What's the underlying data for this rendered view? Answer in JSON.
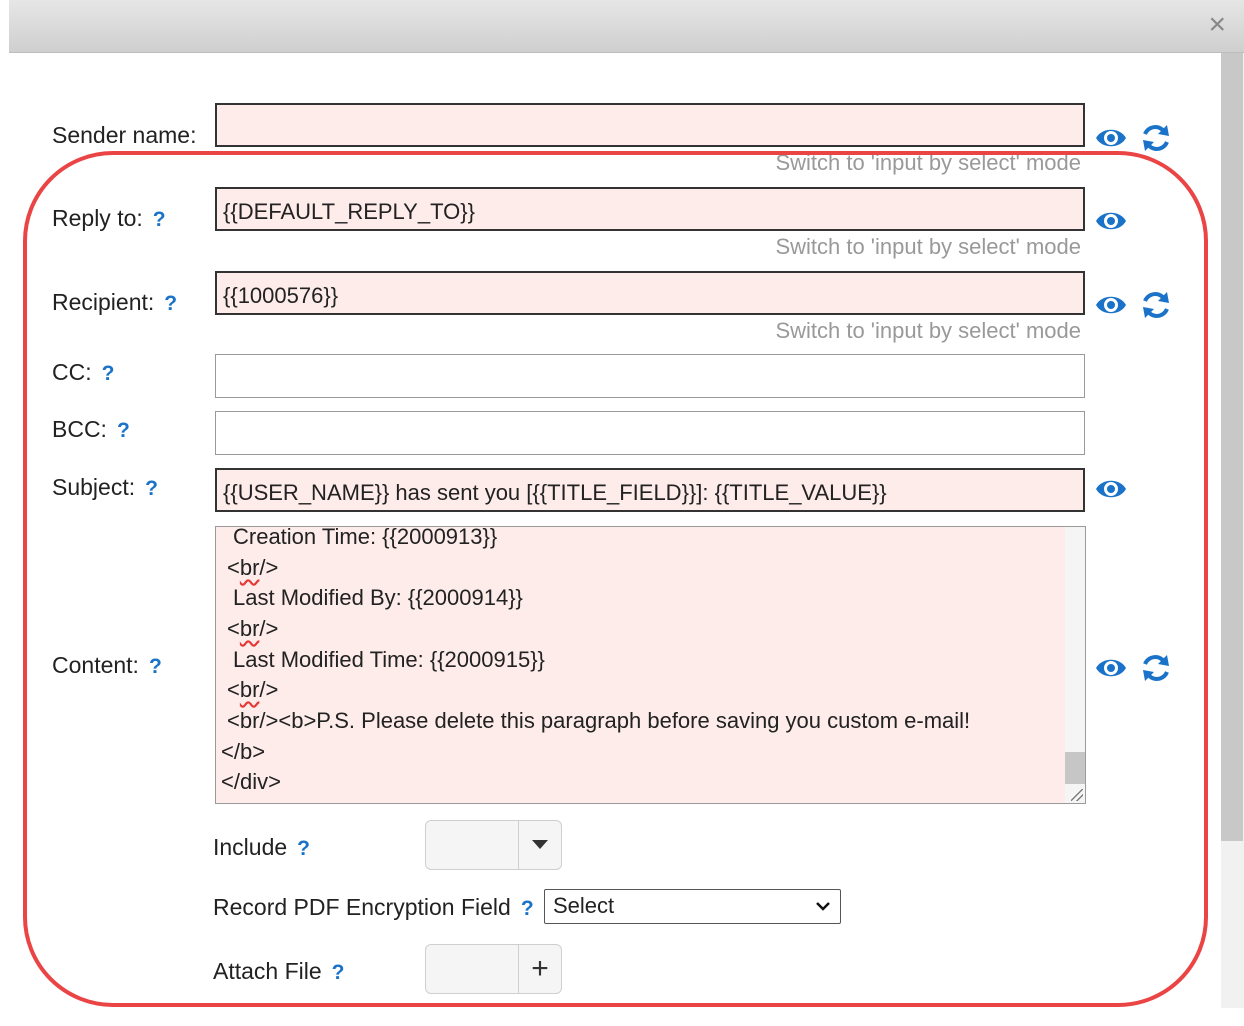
{
  "window": {
    "close_glyph": "×"
  },
  "form": {
    "sender_name": {
      "label": "Sender name:",
      "value": "",
      "switch_text": "Switch to 'input by select' mode"
    },
    "reply_to": {
      "label": "Reply to:",
      "help": "?",
      "value": "{{DEFAULT_REPLY_TO}}",
      "switch_text": "Switch to 'input by select' mode"
    },
    "recipient": {
      "label": "Recipient:",
      "help": "?",
      "value": "{{1000576}}",
      "switch_text": "Switch to 'input by select' mode"
    },
    "cc": {
      "label": "CC:",
      "help": "?",
      "value": ""
    },
    "bcc": {
      "label": "BCC:",
      "help": "?",
      "value": ""
    },
    "subject": {
      "label": "Subject:",
      "help": "?",
      "value": "{{USER_NAME}} has sent you [{{TITLE_FIELD}}]: {{TITLE_VALUE}}"
    },
    "content": {
      "label": "Content:",
      "help": "?",
      "lines": [
        " Creation Time: {{2000913}}",
        "<br/>",
        " Last Modified By: {{2000914}}",
        "<br/>",
        " Last Modified Time: {{2000915}}",
        "<br/>",
        "<br/><b>P.S. Please delete this paragraph before saving you custom e-mail!",
        "</b>",
        "</div>"
      ]
    },
    "include": {
      "label": "Include",
      "help": "?"
    },
    "pdf_encryption": {
      "label": "Record PDF Encryption Field",
      "help": "?",
      "selected": "Select"
    },
    "attach_file": {
      "label": "Attach File",
      "help": "?",
      "add_glyph": "+"
    }
  },
  "colors": {
    "accent": "#1a73c9",
    "field_bg": "#fdecea",
    "highlight": "#ea4444"
  },
  "icons": [
    "eye-icon",
    "refresh-icon",
    "close-icon",
    "caret-down-icon",
    "plus-icon",
    "chevron-down-icon"
  ]
}
